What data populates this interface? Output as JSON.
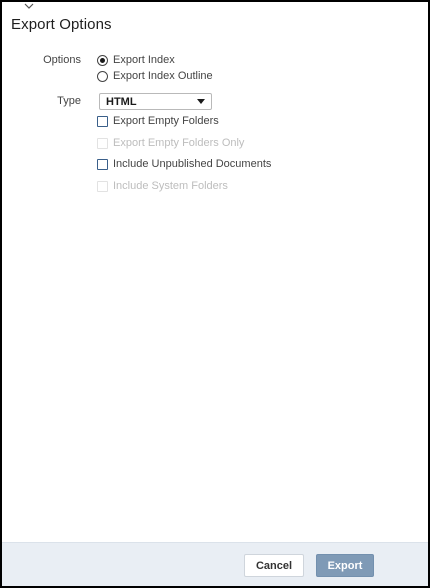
{
  "dialog": {
    "title": "Export Options"
  },
  "options": {
    "label": "Options",
    "choices": [
      {
        "label": "Export Index",
        "selected": true
      },
      {
        "label": "Export Index Outline",
        "selected": false
      }
    ]
  },
  "type": {
    "label": "Type",
    "selected_value": "HTML"
  },
  "checkboxes": [
    {
      "label": "Export Empty Folders",
      "checked": false,
      "enabled": true
    },
    {
      "label": "Export Empty Folders Only",
      "checked": false,
      "enabled": false
    },
    {
      "label": "Include Unpublished Documents",
      "checked": false,
      "enabled": true
    },
    {
      "label": "Include System Folders",
      "checked": false,
      "enabled": false
    }
  ],
  "footer": {
    "cancel_label": "Cancel",
    "export_label": "Export"
  },
  "colors": {
    "footer_bg": "#e9eef4",
    "primary_button": "#7f9ab6",
    "disabled_text": "#bdbdbd"
  }
}
